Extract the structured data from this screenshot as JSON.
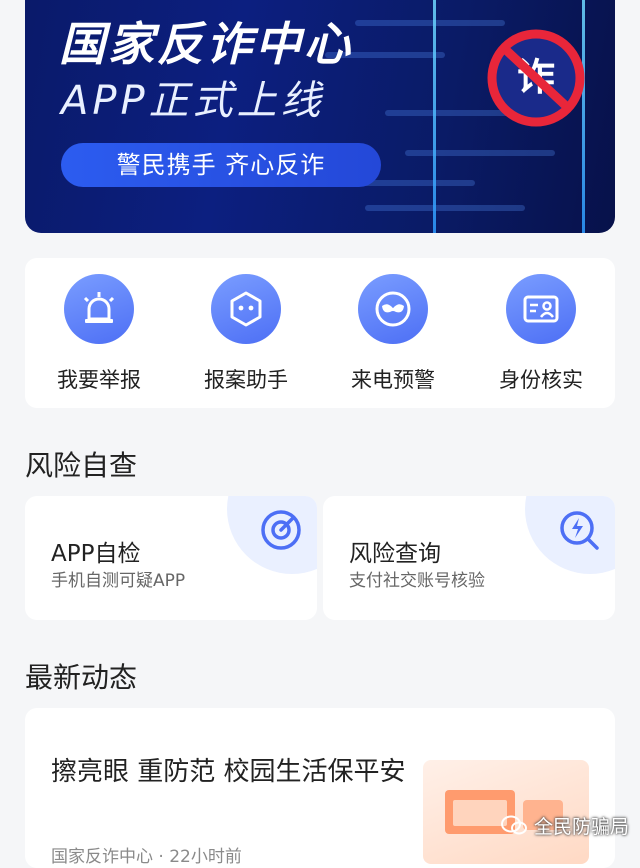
{
  "banner": {
    "title": "国家反诈中心",
    "subtitle": "APP正式上线",
    "slogan": "警民携手    齐心反诈",
    "badge_char": "诈",
    "accent": "#0c1f80"
  },
  "quick_actions": [
    {
      "label": "我要举报",
      "icon": "alarm-light-icon"
    },
    {
      "label": "报案助手",
      "icon": "robot-icon"
    },
    {
      "label": "来电预警",
      "icon": "mask-icon"
    },
    {
      "label": "身份核实",
      "icon": "id-card-icon"
    }
  ],
  "risk_section": {
    "title": "风险自查",
    "cards": [
      {
        "title": "APP自检",
        "subtitle": "手机自测可疑APP",
        "icon": "scan-target-icon"
      },
      {
        "title": "风险查询",
        "subtitle": "支付社交账号核验",
        "icon": "lightning-search-icon"
      }
    ]
  },
  "news_section": {
    "title": "最新动态",
    "items": [
      {
        "headline": "擦亮眼 重防范 校园生活保平安",
        "meta": "国家反诈中心 · 22小时前"
      }
    ]
  },
  "watermark": "全民防骗局",
  "colors": {
    "primary": "#4d6ff5",
    "page_bg": "#f5f6f8",
    "card_bg": "#ffffff"
  }
}
